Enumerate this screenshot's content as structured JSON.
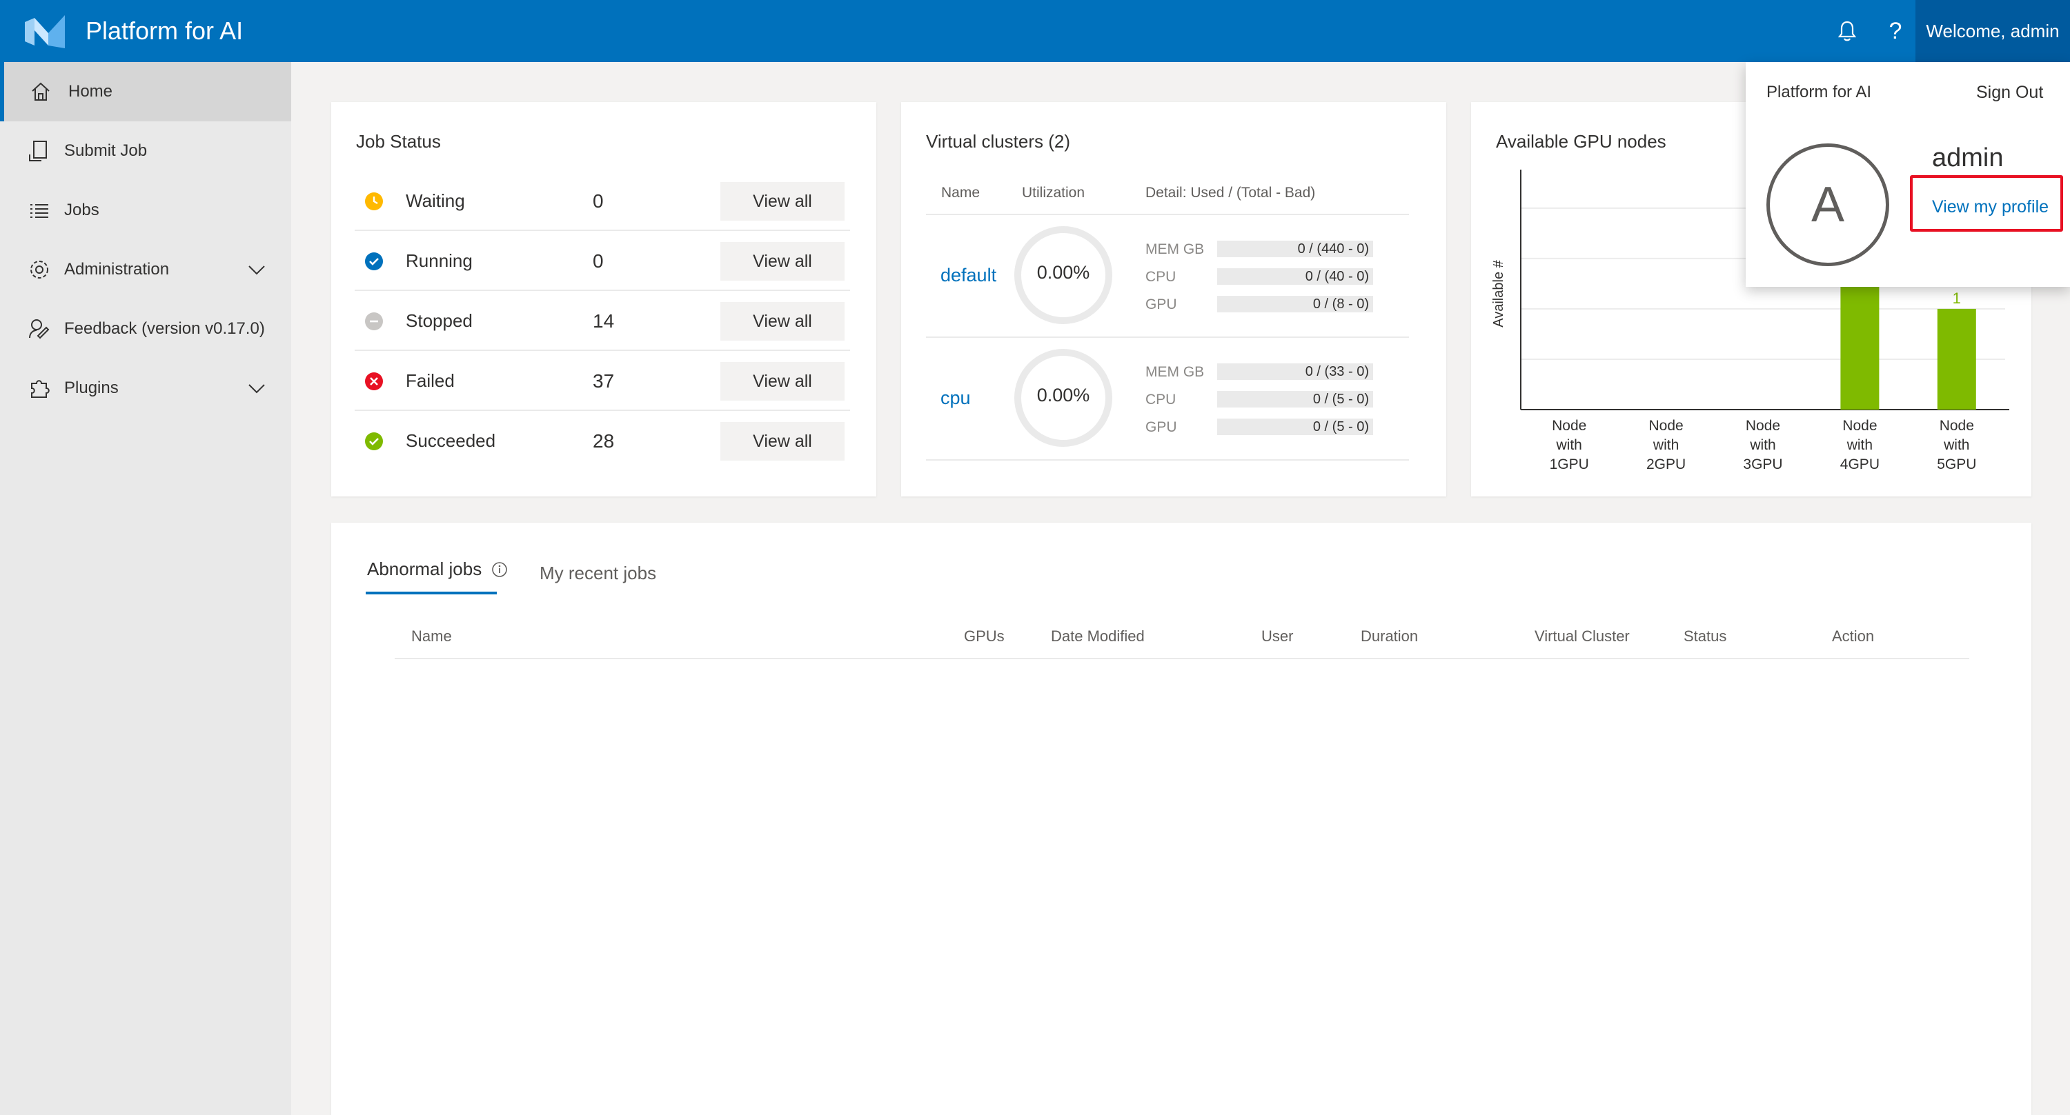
{
  "header": {
    "app_title": "Platform for AI",
    "welcome": "Welcome, admin",
    "help_glyph": "?",
    "brand_color": "#0071bc"
  },
  "sidebar": {
    "items": [
      {
        "label": "Home",
        "icon": "home-icon",
        "active": true
      },
      {
        "label": "Submit Job",
        "icon": "submit-job-icon"
      },
      {
        "label": "Jobs",
        "icon": "list-icon"
      },
      {
        "label": "Administration",
        "icon": "gear-icon",
        "expandable": true
      },
      {
        "label": "Feedback (version v0.17.0)",
        "icon": "feedback-icon"
      },
      {
        "label": "Plugins",
        "icon": "plugin-icon",
        "expandable": true
      }
    ]
  },
  "job_status": {
    "title": "Job Status",
    "view_all_label": "View all",
    "rows": [
      {
        "label": "Waiting",
        "count": "0",
        "color": "#ffb900"
      },
      {
        "label": "Running",
        "count": "0",
        "color": "#0071bc"
      },
      {
        "label": "Stopped",
        "count": "14",
        "color": "#c8c6c4"
      },
      {
        "label": "Failed",
        "count": "37",
        "color": "#e81123"
      },
      {
        "label": "Succeeded",
        "count": "28",
        "color": "#7fba00"
      }
    ]
  },
  "virtual_clusters": {
    "title": "Virtual clusters (2)",
    "columns": [
      "Name",
      "Utilization",
      "Detail: Used / (Total - Bad)"
    ],
    "clusters": [
      {
        "name": "default",
        "utilization": "0.00%",
        "resources": [
          {
            "label": "MEM GB",
            "value": "0 / (440 - 0)"
          },
          {
            "label": "CPU",
            "value": "0 / (40 - 0)"
          },
          {
            "label": "GPU",
            "value": "0 / (8 - 0)"
          }
        ]
      },
      {
        "name": "cpu",
        "utilization": "0.00%",
        "resources": [
          {
            "label": "MEM GB",
            "value": "0 / (33 - 0)"
          },
          {
            "label": "CPU",
            "value": "0 / (5 - 0)"
          },
          {
            "label": "GPU",
            "value": "0 / (5 - 0)"
          }
        ]
      }
    ]
  },
  "gpu_nodes": {
    "title": "Available GPU nodes"
  },
  "chart_data": {
    "type": "bar",
    "ylabel": "Available #",
    "categories": [
      [
        "Node",
        "with",
        "1GPU"
      ],
      [
        "Node",
        "with",
        "2GPU"
      ],
      [
        "Node",
        "with",
        "3GPU"
      ],
      [
        "Node",
        "with",
        "4GPU"
      ],
      [
        "Node",
        "with",
        "5GPU"
      ]
    ],
    "values": [
      0,
      0,
      0,
      2,
      1
    ],
    "data_labels": [
      "",
      "",
      "",
      "",
      "1"
    ],
    "bar_color": "#7fba00",
    "ylim": [
      0,
      2.3
    ],
    "grid": true
  },
  "jobs_panel": {
    "tabs": [
      "Abnormal jobs",
      "My recent jobs"
    ],
    "columns": [
      "Name",
      "GPUs",
      "Date Modified",
      "User",
      "Duration",
      "Virtual Cluster",
      "Status",
      "Action"
    ]
  },
  "profile_popup": {
    "app_name": "Platform for AI",
    "sign_out": "Sign Out",
    "avatar_letter": "A",
    "username": "admin",
    "view_profile": "View my profile",
    "highlight_color": "#e81123"
  }
}
